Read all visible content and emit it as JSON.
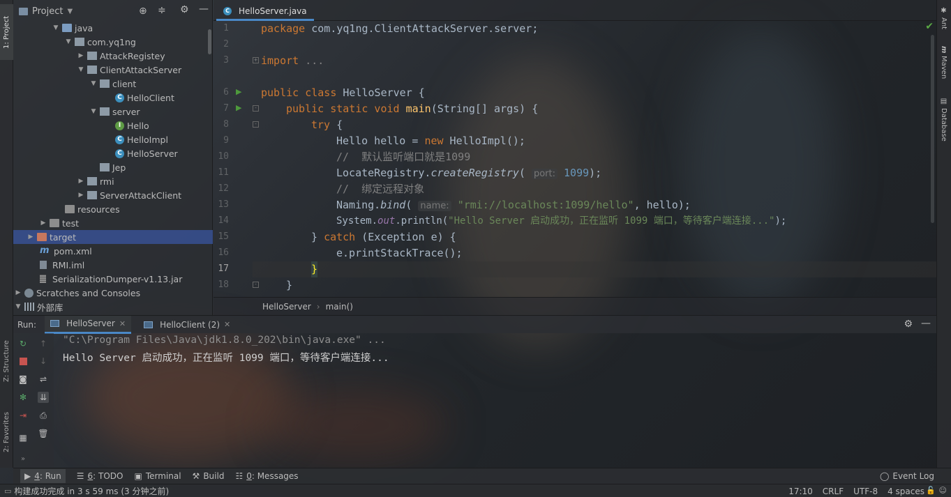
{
  "sidebar_left": {
    "project_tab": "1: Project",
    "structure_tab": "Z: Structure",
    "favorites_tab": "2: Favorites"
  },
  "sidebar_right": {
    "ant": "Ant",
    "maven": "Maven",
    "database": "Database"
  },
  "project_panel": {
    "title": "Project",
    "tree": [
      {
        "label": "java"
      },
      {
        "label": "com.yq1ng"
      },
      {
        "label": "AttackRegistey"
      },
      {
        "label": "ClientAttackServer"
      },
      {
        "label": "client"
      },
      {
        "label": "HelloClient"
      },
      {
        "label": "server"
      },
      {
        "label": "Hello"
      },
      {
        "label": "HelloImpl"
      },
      {
        "label": "HelloServer"
      },
      {
        "label": "Jep"
      },
      {
        "label": "rmi"
      },
      {
        "label": "ServerAttackClient"
      },
      {
        "label": "resources"
      },
      {
        "label": "test"
      },
      {
        "label": "target"
      },
      {
        "label": "pom.xml"
      },
      {
        "label": "RMI.iml"
      },
      {
        "label": "SerializationDumper-v1.13.jar"
      },
      {
        "label": "Scratches and Consoles"
      },
      {
        "label": "外部库"
      }
    ]
  },
  "editor": {
    "tab": "HelloServer.java",
    "line_numbers": [
      "1",
      "2",
      "3",
      "6",
      "7",
      "8",
      "9",
      "10",
      "11",
      "12",
      "13",
      "14",
      "15",
      "16",
      "17",
      "18"
    ],
    "code": {
      "l1_kw": "package",
      "l1_rest": " com.yq1ng.ClientAttackServer.server;",
      "l3_kw": "import",
      "l3_rest": " ...",
      "l6_kw": "public class",
      "l6_rest": " HelloServer {",
      "l7_kw": "public static void",
      "l7_fn": "main",
      "l7_rest": "(String[] args) {",
      "l8_kw": "try",
      "l8_rest": " {",
      "l9_a": "Hello hello = ",
      "l9_kw": "new",
      "l9_b": " HelloImpl();",
      "l10_cm": "//  默认监听端口就是1099",
      "l11_a": "LocateRegistry.",
      "l11_it": "createRegistry",
      "l11_b": "(",
      "l11_hint": "port:",
      "l11_num": "1099",
      "l11_c": ");",
      "l12_cm": "//  绑定远程对象",
      "l13_a": "Naming.",
      "l13_it": "bind",
      "l13_b": "(",
      "l13_hint": "name:",
      "l13_str": "\"rmi://localhost:1099/hello\"",
      "l13_c": ", hello);",
      "l14_a": "System.",
      "l14_pf": "out",
      "l14_b": ".println(",
      "l14_str": "\"Hello Server 启动成功，正在监听 1099 端口，等待客户端连接...\"",
      "l14_c": ");",
      "l15_a": "} ",
      "l15_kw": "catch",
      "l15_b": " (Exception e) {",
      "l16": "e.printStackTrace();",
      "l17": "}",
      "l18": "}"
    },
    "breadcrumbs": [
      "HelloServer",
      "main()"
    ]
  },
  "run_panel": {
    "label": "Run:",
    "tabs": [
      "HelloServer",
      "HelloClient (2)"
    ],
    "console": [
      "\"C:\\Program Files\\Java\\jdk1.8.0_202\\bin\\java.exe\" ...",
      "Hello Server 启动成功，正在监听 1099 端口，等待客户端连接..."
    ]
  },
  "tool_strip": {
    "run_num": "4",
    "run": "Run",
    "todo_num": "6",
    "todo": "TODO",
    "terminal": "Terminal",
    "build": "Build",
    "messages_num": "0",
    "messages": "Messages",
    "event_log": "Event Log"
  },
  "status_bar": {
    "message": "构建成功完成 in 3 s 59 ms (3 分钟之前)",
    "position": "17:10",
    "line_sep": "CRLF",
    "encoding": "UTF-8",
    "indent": "4 spaces"
  },
  "colors": {
    "keyword": "#cc7832",
    "string": "#6a8759",
    "comment": "#808080",
    "number": "#6897bb",
    "function": "#ffc66d",
    "selection": "#3955a0"
  }
}
